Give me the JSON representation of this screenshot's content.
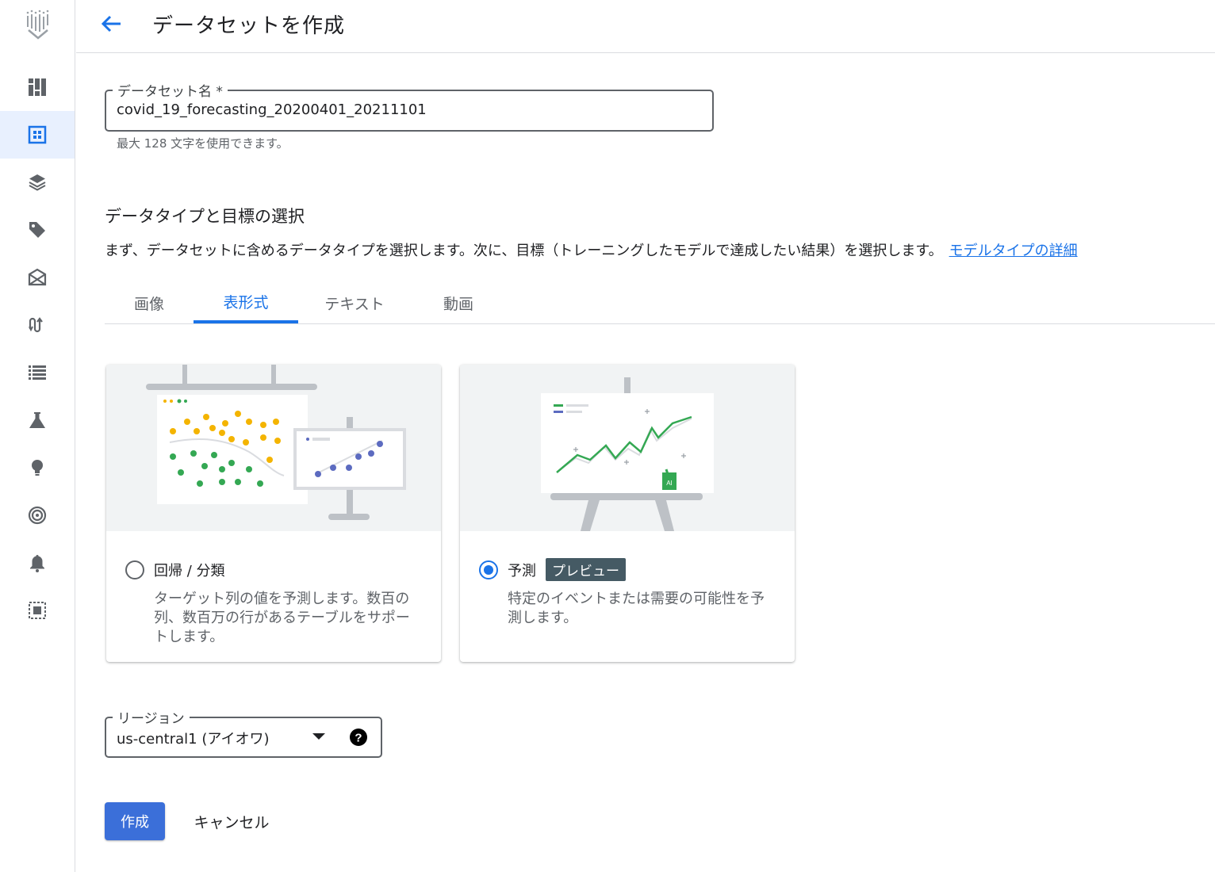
{
  "header": {
    "title": "データセットを作成"
  },
  "sidebar": {
    "items": [
      {
        "icon": "dashboard-icon"
      },
      {
        "icon": "dataset-icon"
      },
      {
        "icon": "labeling-icon"
      },
      {
        "icon": "tag-icon"
      },
      {
        "icon": "workbench-icon"
      },
      {
        "icon": "pipelines-icon"
      },
      {
        "icon": "list-icon"
      },
      {
        "icon": "experiments-icon"
      },
      {
        "icon": "lightbulb-icon"
      },
      {
        "icon": "target-icon"
      },
      {
        "icon": "bell-icon"
      },
      {
        "icon": "region-icon"
      }
    ],
    "active_index": 1
  },
  "dataset_name": {
    "label": "データセット名 *",
    "value": "covid_19_forecasting_20200401_20211101",
    "hint": "最大 128 文字を使用できます。"
  },
  "section": {
    "title": "データタイプと目標の選択",
    "description": "まず、データセットに含めるデータタイプを選択します。次に、目標（トレーニングしたモデルで達成したい結果）を選択します。",
    "link": "モデルタイプの詳細"
  },
  "tabs": [
    {
      "label": "画像"
    },
    {
      "label": "表形式"
    },
    {
      "label": "テキスト"
    },
    {
      "label": "動画"
    }
  ],
  "active_tab": "表形式",
  "options": [
    {
      "title": "回帰 / 分類",
      "description": "ターゲット列の値を予測します。数百の列、数百万の行があるテーブルをサポートします。",
      "selected": false
    },
    {
      "title": "予測",
      "badge": "プレビュー",
      "description": "特定のイベントまたは需要の可能性を予測します。",
      "selected": true
    }
  ],
  "region": {
    "label": "リージョン",
    "value": "us-central1 (アイオワ)"
  },
  "buttons": {
    "create": "作成",
    "cancel": "キャンセル"
  },
  "colors": {
    "accent": "#1a73e8",
    "primary_button": "#3b6fd9",
    "badge": "#455a64"
  }
}
